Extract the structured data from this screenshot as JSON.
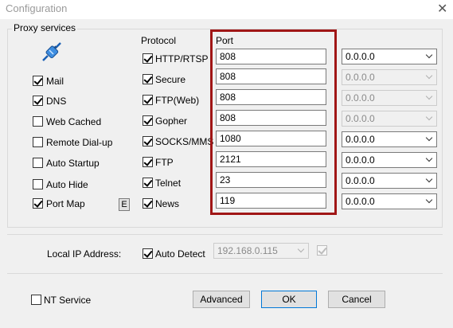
{
  "window": {
    "title": "Configuration"
  },
  "group_label": "Proxy services",
  "column_protocol": "Protocol",
  "column_port": "Port",
  "services": [
    {
      "label": "Mail",
      "checked": true
    },
    {
      "label": "DNS",
      "checked": true
    },
    {
      "label": "Web Cached",
      "checked": false
    },
    {
      "label": "Remote Dial-up",
      "checked": false
    },
    {
      "label": "Auto Startup",
      "checked": false
    },
    {
      "label": "Auto Hide",
      "checked": false
    },
    {
      "label": "Port Map",
      "checked": true
    }
  ],
  "port_map_edit_label": "E",
  "protocols": [
    {
      "label": "HTTP/RTSP",
      "checked": true,
      "port": "808",
      "ip": "0.0.0.0",
      "ip_enabled": true
    },
    {
      "label": "Secure",
      "checked": true,
      "port": "808",
      "ip": "0.0.0.0",
      "ip_enabled": false
    },
    {
      "label": "FTP(Web)",
      "checked": true,
      "port": "808",
      "ip": "0.0.0.0",
      "ip_enabled": false
    },
    {
      "label": "Gopher",
      "checked": true,
      "port": "808",
      "ip": "0.0.0.0",
      "ip_enabled": false
    },
    {
      "label": "SOCKS/MMS",
      "checked": true,
      "port": "1080",
      "ip": "0.0.0.0",
      "ip_enabled": true
    },
    {
      "label": "FTP",
      "checked": true,
      "port": "2121",
      "ip": "0.0.0.0",
      "ip_enabled": true
    },
    {
      "label": "Telnet",
      "checked": true,
      "port": "23",
      "ip": "0.0.0.0",
      "ip_enabled": true
    },
    {
      "label": "News",
      "checked": true,
      "port": "119",
      "ip": "0.0.0.0",
      "ip_enabled": true
    }
  ],
  "local_ip": {
    "label": "Local IP Address:",
    "auto_detect_label": "Auto Detect",
    "auto_detect_checked": true,
    "value": "192.168.0.115"
  },
  "footer": {
    "nt_service_label": "NT Service",
    "nt_service_checked": false,
    "advanced_label": "Advanced",
    "ok_label": "OK",
    "cancel_label": "Cancel"
  },
  "colors": {
    "highlight_border": "#a01616",
    "default_button_border": "#0078d7"
  }
}
